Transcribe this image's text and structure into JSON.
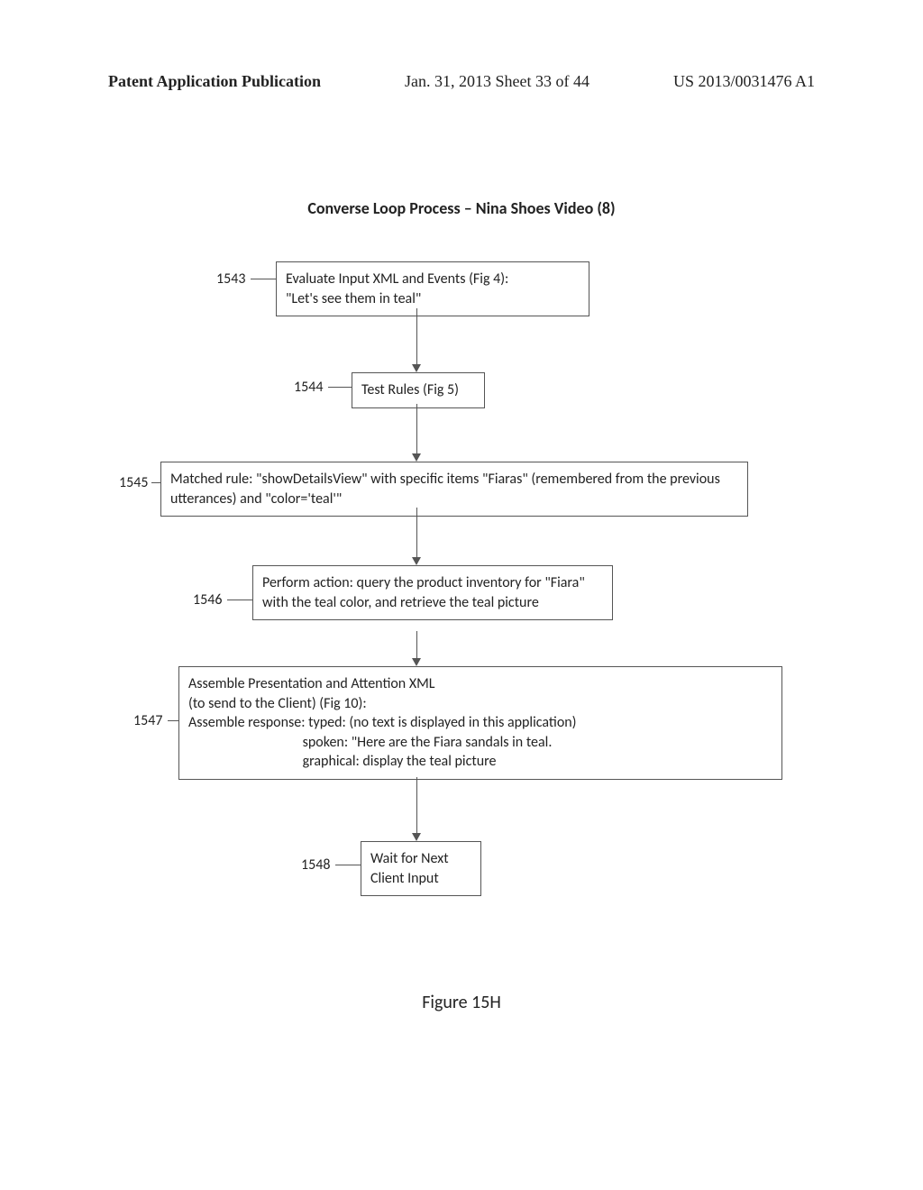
{
  "header": {
    "left": "Patent Application Publication",
    "center": "Jan. 31, 2013  Sheet 33 of 44",
    "right": "US 2013/0031476 A1"
  },
  "title": "Converse Loop Process – Nina Shoes Video (8)",
  "nodes": {
    "n1543": {
      "ref": "1543",
      "text": "Evaluate Input XML and Events (Fig 4):\n\"Let's see them in teal\""
    },
    "n1544": {
      "ref": "1544",
      "text": "Test Rules (Fig 5)"
    },
    "n1545": {
      "ref": "1545",
      "text": "Matched rule: \"showDetailsView\" with specific items \"Fiaras\" (remembered from the previous utterances) and \"color='teal'\""
    },
    "n1546": {
      "ref": "1546",
      "text": "Perform action: query the product inventory for \"Fiara\" with the teal color, and retrieve the teal picture"
    },
    "n1547": {
      "ref": "1547",
      "text": "Assemble Presentation and Attention XML\n(to send to the Client) (Fig 10):\nAssemble response: typed: (no text is displayed in this application)\n                                   spoken: \"Here are the Fiara sandals in teal.\n                                   graphical: display the teal picture"
    },
    "n1548": {
      "ref": "1548",
      "text": "Wait for Next Client Input"
    }
  },
  "figure_label": "Figure 15H"
}
